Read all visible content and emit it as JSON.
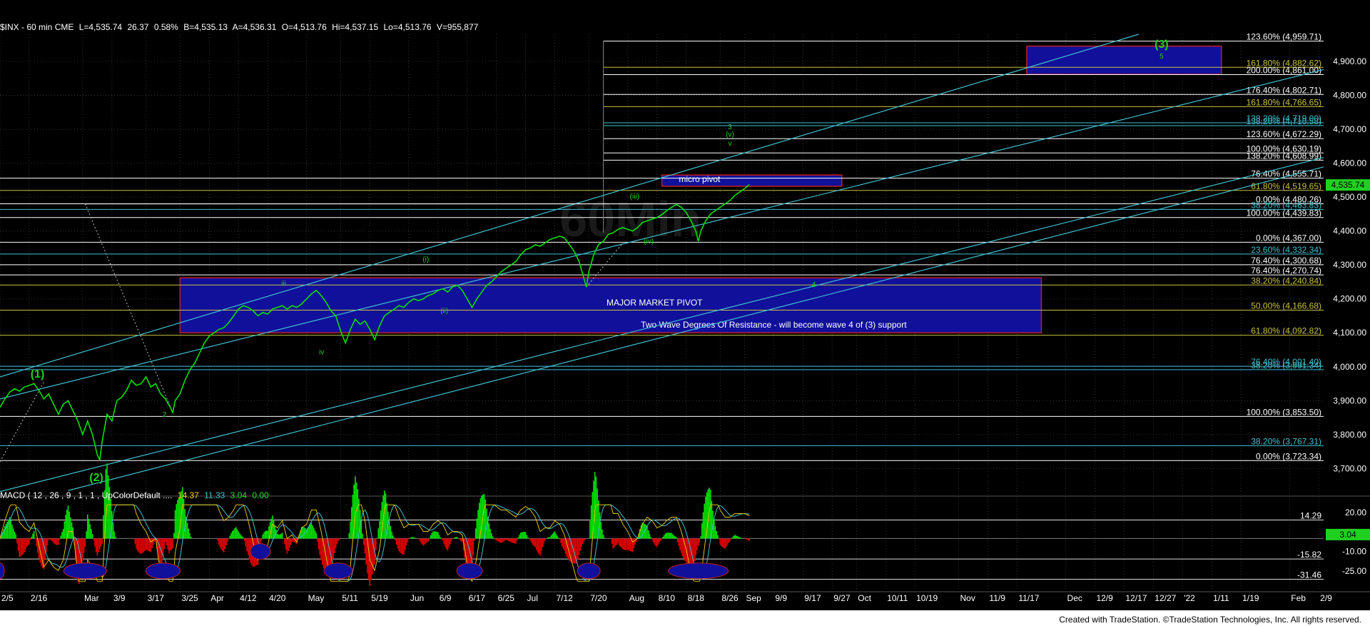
{
  "header": {
    "symbol": "$INX - 60 min  CME",
    "last": "L=4,535.74",
    "change": "26.37",
    "change_pct": "0.58%",
    "bid": "B=4,535.13",
    "ask": "A=4,536.31",
    "open": "O=4,513.76",
    "high": "Hi=4,537.15",
    "low": "Lo=4,513.76",
    "volume": "V=955,877"
  },
  "macd_header": {
    "label": "MACD ( 12 , 26 , 9 , 1 , 1 , UpColorDefault ....",
    "v1": "14.37",
    "v2": "11.33",
    "v3": "3.04",
    "v4": "0.00"
  },
  "footer": "Created with TradeStation. ©TradeStation Technologies, Inc. All rights reserved.",
  "watermark": "60Min",
  "colors": {
    "price": "#00e000",
    "fib_white": "#ffffff",
    "fib_cyan": "#40c0d0",
    "fib_olive": "#c8c040",
    "zone_fill": "#10109a",
    "zone_border": "#c02020",
    "wave_label": "#20d020",
    "last_price_bg": "#20d020",
    "macd_green": "#00e000",
    "macd_red": "#e00000",
    "macd_line": "#e0c000",
    "signal_line": "#40c0d0",
    "ellipse_fill": "#10109a"
  },
  "chart_data": {
    "type": "line",
    "title": "$INX - 60 min",
    "y_axis": {
      "min": 3625,
      "max": 4980,
      "ticks": [
        3700,
        3800,
        3900,
        4000,
        4100,
        4200,
        4300,
        4400,
        4500,
        4600,
        4700,
        4800,
        4900
      ],
      "tick_labels": [
        "3,700.00",
        "3,800.00",
        "3,900.00",
        "4,000.00",
        "4,100.00",
        "4,200.00",
        "4,300.00",
        "4,400.00",
        "4,500.00",
        "4,600.00",
        "4,700.00",
        "4,800.00",
        "4,900.00"
      ]
    },
    "x_axis": {
      "labels": [
        "2/5",
        "2/16",
        "Mar",
        "3/9",
        "3/17",
        "3/25",
        "Apr",
        "4/12",
        "4/20",
        "May",
        "5/11",
        "5/19",
        "Jun",
        "6/9",
        "6/17",
        "6/25",
        "Jul",
        "7/12",
        "7/20",
        "Aug",
        "8/10",
        "8/18",
        "8/26",
        "Sep",
        "9/9",
        "9/17",
        "9/27",
        "Oct",
        "10/11",
        "10/19",
        "Nov",
        "11/9",
        "11/17",
        "Dec",
        "12/9",
        "12/17",
        "12/27",
        "'22",
        "1/11",
        "1/19",
        "Feb",
        "2/9"
      ],
      "positions": [
        0,
        6,
        17,
        23,
        30,
        37,
        43,
        49,
        55,
        63,
        70,
        76,
        84,
        90,
        96,
        102,
        108,
        114,
        121,
        129,
        135,
        141,
        148,
        153,
        159,
        165,
        171,
        176,
        182,
        188,
        197,
        203,
        209,
        219,
        225,
        231,
        237,
        243,
        249,
        255,
        265,
        271
      ],
      "max": 272
    },
    "last_price": 4535.74,
    "last_price_label": "4,535.74",
    "series": [
      {
        "values": [
          [
            0,
            3880
          ],
          [
            1,
            3905
          ],
          [
            2,
            3925
          ],
          [
            3,
            3935
          ],
          [
            4,
            3928
          ],
          [
            5,
            3940
          ],
          [
            6,
            3945
          ],
          [
            7,
            3950
          ],
          [
            8,
            3930
          ],
          [
            9,
            3905
          ],
          [
            10,
            3920
          ],
          [
            11,
            3890
          ],
          [
            12,
            3860
          ],
          [
            13,
            3890
          ],
          [
            14,
            3900
          ],
          [
            15,
            3870
          ],
          [
            16,
            3840
          ],
          [
            17,
            3800
          ],
          [
            18,
            3840
          ],
          [
            19,
            3800
          ],
          [
            20,
            3740
          ],
          [
            20.5,
            3725
          ],
          [
            21,
            3780
          ],
          [
            22,
            3860
          ],
          [
            23,
            3840
          ],
          [
            24,
            3900
          ],
          [
            25,
            3910
          ],
          [
            26,
            3930
          ],
          [
            27,
            3960
          ],
          [
            28,
            3945
          ],
          [
            29,
            3950
          ],
          [
            30,
            3970
          ],
          [
            31,
            3940
          ],
          [
            32,
            3950
          ],
          [
            33,
            3920
          ],
          [
            34,
            3905
          ],
          [
            35,
            3880
          ],
          [
            35.5,
            3865
          ],
          [
            36,
            3900
          ],
          [
            37,
            3920
          ],
          [
            38,
            3960
          ],
          [
            39,
            3990
          ],
          [
            40,
            4010
          ],
          [
            41,
            4040
          ],
          [
            42,
            4070
          ],
          [
            43,
            4090
          ],
          [
            44,
            4100
          ],
          [
            45,
            4110
          ],
          [
            46,
            4115
          ],
          [
            47,
            4130
          ],
          [
            48,
            4150
          ],
          [
            49,
            4170
          ],
          [
            50,
            4180
          ],
          [
            51,
            4175
          ],
          [
            52,
            4165
          ],
          [
            53,
            4150
          ],
          [
            54,
            4160
          ],
          [
            55,
            4155
          ],
          [
            56,
            4170
          ],
          [
            57,
            4175
          ],
          [
            58,
            4180
          ],
          [
            59,
            4170
          ],
          [
            60,
            4180
          ],
          [
            61,
            4175
          ],
          [
            62,
            4185
          ],
          [
            63,
            4200
          ],
          [
            64,
            4215
          ],
          [
            65,
            4225
          ],
          [
            66,
            4210
          ],
          [
            67,
            4190
          ],
          [
            68,
            4165
          ],
          [
            69,
            4150
          ],
          [
            70,
            4105
          ],
          [
            71,
            4070
          ],
          [
            72,
            4110
          ],
          [
            73,
            4140
          ],
          [
            74,
            4125
          ],
          [
            75,
            4135
          ],
          [
            76,
            4110
          ],
          [
            77,
            4080
          ],
          [
            78,
            4120
          ],
          [
            79,
            4150
          ],
          [
            80,
            4160
          ],
          [
            81,
            4170
          ],
          [
            82,
            4180
          ],
          [
            83,
            4175
          ],
          [
            84,
            4190
          ],
          [
            85,
            4200
          ],
          [
            86,
            4195
          ],
          [
            87,
            4200
          ],
          [
            88,
            4210
          ],
          [
            89,
            4215
          ],
          [
            90,
            4225
          ],
          [
            91,
            4230
          ],
          [
            92,
            4220
          ],
          [
            93,
            4235
          ],
          [
            94,
            4240
          ],
          [
            95,
            4225
          ],
          [
            96,
            4200
          ],
          [
            97,
            4175
          ],
          [
            98,
            4200
          ],
          [
            99,
            4220
          ],
          [
            100,
            4240
          ],
          [
            101,
            4250
          ],
          [
            102,
            4265
          ],
          [
            103,
            4280
          ],
          [
            104,
            4290
          ],
          [
            105,
            4300
          ],
          [
            106,
            4310
          ],
          [
            107,
            4330
          ],
          [
            108,
            4345
          ],
          [
            109,
            4350
          ],
          [
            110,
            4360
          ],
          [
            111,
            4355
          ],
          [
            112,
            4365
          ],
          [
            113,
            4375
          ],
          [
            114,
            4380
          ],
          [
            115,
            4385
          ],
          [
            116,
            4380
          ],
          [
            117,
            4360
          ],
          [
            118,
            4340
          ],
          [
            119,
            4310
          ],
          [
            120,
            4260
          ],
          [
            120.5,
            4235
          ],
          [
            121,
            4280
          ],
          [
            122,
            4330
          ],
          [
            123,
            4360
          ],
          [
            124,
            4370
          ],
          [
            125,
            4390
          ],
          [
            126,
            4395
          ],
          [
            127,
            4405
          ],
          [
            128,
            4410
          ],
          [
            129,
            4405
          ],
          [
            130,
            4400
          ],
          [
            131,
            4410
          ],
          [
            132,
            4425
          ],
          [
            133,
            4430
          ],
          [
            134,
            4435
          ],
          [
            135,
            4440
          ],
          [
            136,
            4448
          ],
          [
            137,
            4460
          ],
          [
            138,
            4470
          ],
          [
            139,
            4478
          ],
          [
            140,
            4470
          ],
          [
            141,
            4455
          ],
          [
            142,
            4430
          ],
          [
            143,
            4400
          ],
          [
            143.5,
            4370
          ],
          [
            144,
            4400
          ],
          [
            145,
            4430
          ],
          [
            146,
            4450
          ],
          [
            147,
            4460
          ],
          [
            148,
            4470
          ],
          [
            149,
            4480
          ],
          [
            150,
            4490
          ],
          [
            151,
            4505
          ],
          [
            152,
            4515
          ],
          [
            153,
            4525
          ],
          [
            154,
            4537
          ]
        ]
      }
    ],
    "fib_levels": [
      {
        "value": 4959.71,
        "label": "123.60% (4,959.71)",
        "color": "white"
      },
      {
        "value": 4882.62,
        "label": "161.80% (4,882.62)",
        "color": "olive"
      },
      {
        "value": 4861.0,
        "label": "200.00% (4,861.00)",
        "color": "white"
      },
      {
        "value": 4802.71,
        "label": "176.40% (4,802.71)",
        "color": "white"
      },
      {
        "value": 4766.65,
        "label": "161.80% (4,766.65)",
        "color": "olive"
      },
      {
        "value": 4719.0,
        "label": "138.20% (4,719.00)",
        "color": "cyan"
      },
      {
        "value": 4710.58,
        "label": "138.20% (4,710.58)",
        "color": "cyan"
      },
      {
        "value": 4672.29,
        "label": "123.60% (4,672.29)",
        "color": "white"
      },
      {
        "value": 4630.19,
        "label": "100.00% (4,630.19)",
        "color": "white"
      },
      {
        "value": 4608.99,
        "label": "138.20% (4,608.99)",
        "color": "white"
      },
      {
        "value": 4555.71,
        "label": "76.40% (4,555.71)",
        "color": "white"
      },
      {
        "value": 4519.65,
        "label": "61.80% (4,519.65)",
        "color": "olive"
      },
      {
        "value": 4480.26,
        "label": "0.00% (4,480.26)",
        "color": "white"
      },
      {
        "value": 4463.83,
        "label": "38.20% (4,463.83)",
        "color": "cyan"
      },
      {
        "value": 4439.83,
        "label": "100.00% (4,439.83)",
        "color": "white"
      },
      {
        "value": 4367.0,
        "label": "0.00% (4,367.00)",
        "color": "white"
      },
      {
        "value": 4332.34,
        "label": "23.60% (4,332.34)",
        "color": "cyan"
      },
      {
        "value": 4300.68,
        "label": "76.40% (4,300.68)",
        "color": "white"
      },
      {
        "value": 4270.74,
        "label": "76.40% (4,270.74)",
        "color": "white"
      },
      {
        "value": 4240.84,
        "label": "38.20% (4,240.84)",
        "color": "olive"
      },
      {
        "value": 4166.68,
        "label": "50.00% (4,166.68)",
        "color": "olive"
      },
      {
        "value": 4092.82,
        "label": "61.80% (4,092.82)",
        "color": "olive"
      },
      {
        "value": 4001.4,
        "label": "76.40% (4,001.40)",
        "color": "cyan"
      },
      {
        "value": 3991.34,
        "label": "38.20% (3,991.34)",
        "color": "cyan"
      },
      {
        "value": 3853.5,
        "label": "100.00% (3,853.50)",
        "color": "white"
      },
      {
        "value": 3767.31,
        "label": "38.20% (3,767.31)",
        "color": "cyan"
      },
      {
        "value": 3723.34,
        "label": "0.00% (3,723.34)",
        "color": "white"
      }
    ],
    "zones": [
      {
        "x1": 37,
        "x2": 214,
        "y1": 4262,
        "y2": 4100,
        "labels": [
          "MAJOR MARKET PIVOT",
          "Two Wave Degrees Of Resistance - will become wave 4 of (3) support"
        ]
      },
      {
        "x1": 136,
        "x2": 173,
        "y1": 4565,
        "y2": 4532,
        "labels": [
          "micro pivot"
        ]
      },
      {
        "x1": 211,
        "x2": 251,
        "y1": 4945,
        "y2": 4862,
        "labels": []
      }
    ],
    "wave_labels": [
      {
        "x": 7.7,
        "y": 3968,
        "text": "(1)"
      },
      {
        "x": 19.8,
        "y": 3663,
        "text": "(2)"
      },
      {
        "x": 33.8,
        "y": 3852,
        "text": "2"
      },
      {
        "x": 58.3,
        "y": 4238,
        "text": "iii"
      },
      {
        "x": 66.1,
        "y": 4036,
        "text": "iv"
      },
      {
        "x": 87.5,
        "y": 4310,
        "text": "(i)"
      },
      {
        "x": 91.3,
        "y": 4158,
        "text": "(ii)"
      },
      {
        "x": 130.4,
        "y": 4495,
        "text": "(iii)"
      },
      {
        "x": 133.3,
        "y": 4363,
        "text": "(iv)"
      },
      {
        "x": 167.2,
        "y": 4235,
        "text": "4"
      },
      {
        "x": 150,
        "y": 4700,
        "text": "3"
      },
      {
        "x": 150,
        "y": 4678,
        "text": "(v)"
      },
      {
        "x": 150,
        "y": 4652,
        "text": "v"
      },
      {
        "x": 238.7,
        "y": 4940,
        "text": "(3)"
      },
      {
        "x": 238.7,
        "y": 4908,
        "text": "5"
      }
    ],
    "channels": [
      {
        "x1": 0,
        "y1": 3970,
        "x2": 234,
        "y2": 4980
      },
      {
        "x1": 0,
        "y1": 3905,
        "x2": 272,
        "y2": 4876
      },
      {
        "x1": 0,
        "y1": 3632,
        "x2": 272,
        "y2": 4617
      },
      {
        "x1": 14,
        "y1": 3635,
        "x2": 272,
        "y2": 4589
      }
    ],
    "macd": {
      "label": "MACD ( 12 , 26 , 9 , 1 , 1 , UpColorDefault ....",
      "values": {
        "macd": 14.37,
        "signal": 11.33,
        "hist": 3.04,
        "zero": 0.0
      },
      "levels": [
        {
          "value": 14.29,
          "label": "14.29"
        },
        {
          "value": -15.82,
          "label": "-15.82"
        },
        {
          "value": -31.46,
          "label": "-31.46"
        }
      ],
      "ticks": [
        20,
        -10,
        -25
      ],
      "tick_labels": [
        "20.00",
        "-10.00",
        "-25.00"
      ],
      "last_label": "3.04",
      "ymin": -40,
      "ymax": 30
    }
  }
}
